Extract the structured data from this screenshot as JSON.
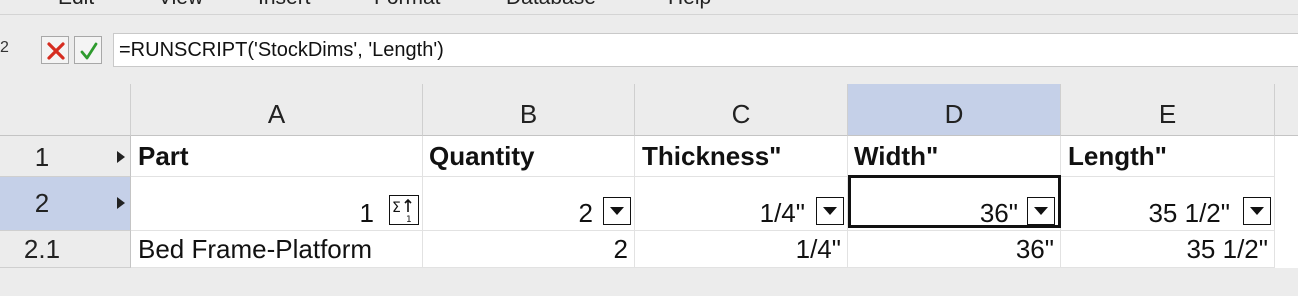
{
  "menubar": {
    "items": [
      "Edit",
      "View",
      "Insert",
      "Format",
      "Database",
      "Help"
    ]
  },
  "formula_bar": {
    "cell_reference": "2",
    "formula": "=RUNSCRIPT('StockDims', 'Length')",
    "cancel_icon": "x-icon",
    "accept_icon": "checkmark-icon"
  },
  "columns": [
    "A",
    "B",
    "C",
    "D",
    "E"
  ],
  "selected_column": "D",
  "rows": [
    {
      "header": "1",
      "cells": [
        "Part",
        "Quantity",
        "Thickness\"",
        "Width\"",
        "Length\""
      ]
    },
    {
      "header": "2",
      "cells": [
        "1",
        "2",
        "1/4\"",
        "36\"",
        "35 1/2\""
      ]
    },
    {
      "header": "2.1",
      "cells": [
        "Bed Frame-Platform",
        "2",
        "1/4\"",
        "36\"",
        "35 1/2\""
      ]
    }
  ],
  "selected_row": "2",
  "active_cell": "D2",
  "colors": {
    "selection_header": "#c5d0e8",
    "cancel": "#d62d20",
    "accept": "#2e9b2e"
  }
}
